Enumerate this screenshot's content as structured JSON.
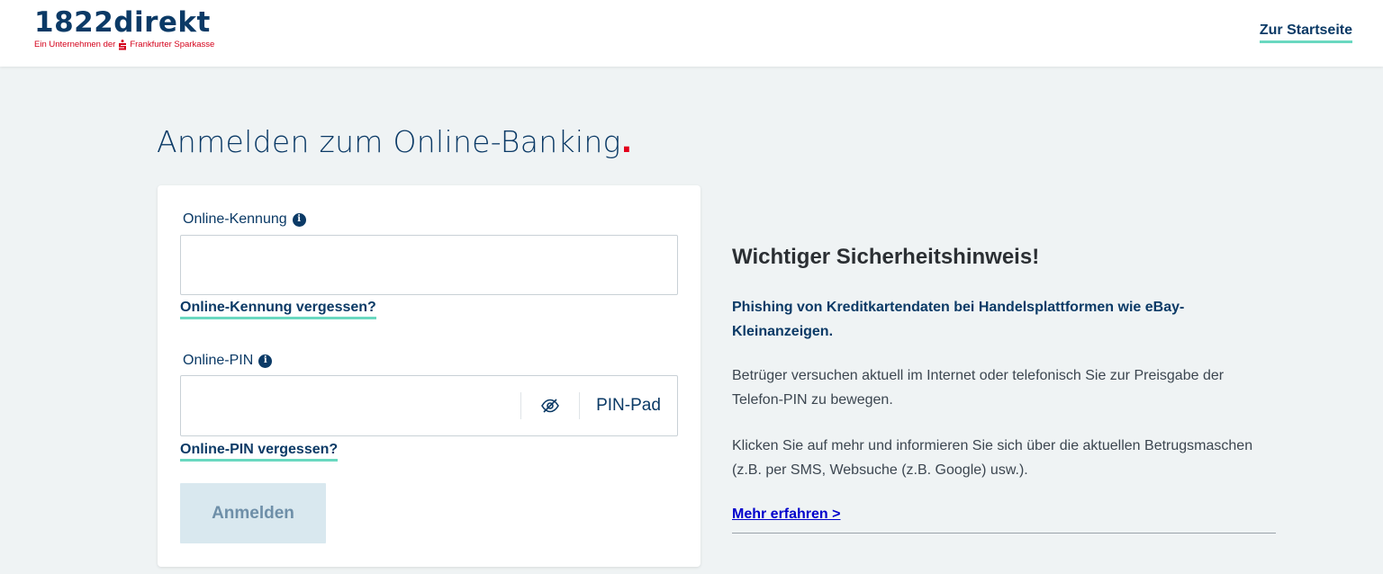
{
  "header": {
    "logo_text": "1822direkt",
    "logo_sub_prefix": "Ein Unternehmen der",
    "logo_sub_suffix": "Frankfurter Sparkasse",
    "home_link": "Zur Startseite"
  },
  "page": {
    "title": "Anmelden zum Online-Banking",
    "title_dot": "."
  },
  "login": {
    "id_label": "Online-Kennung",
    "id_value": "",
    "id_forgot": "Online-Kennung vergessen?",
    "pin_label": "Online-PIN",
    "pin_value": "",
    "pinpad_label": "PIN-Pad",
    "pin_forgot": "Online-PIN vergessen?",
    "submit_label": "Anmelden"
  },
  "notice": {
    "title": "Wichtiger Sicherheitshinweis!",
    "subtitle": "Phishing von Kreditkartendaten bei Handelsplattformen wie eBay-Kleinanzeigen.",
    "paragraph1": "Betrüger versuchen aktuell im Internet oder telefonisch Sie zur Preisgabe der Telefon-PIN zu bewegen.",
    "paragraph2": "Klicken Sie auf mehr und informieren Sie sich über die aktuellen Betrugsmaschen (z.B. per SMS, Websuche (z.B. Google) usw.).",
    "more_link": "Mehr erfahren >"
  },
  "icons": {
    "info": "info-icon",
    "eye": "eye-slash-icon",
    "sparkasse": "sparkasse-s-icon"
  },
  "colors": {
    "brand_blue": "#0b3a66",
    "accent_red": "#e3001b",
    "underline_green": "#6ad8c0",
    "background": "#eff3f4",
    "button_disabled": "#d9e8ef"
  }
}
